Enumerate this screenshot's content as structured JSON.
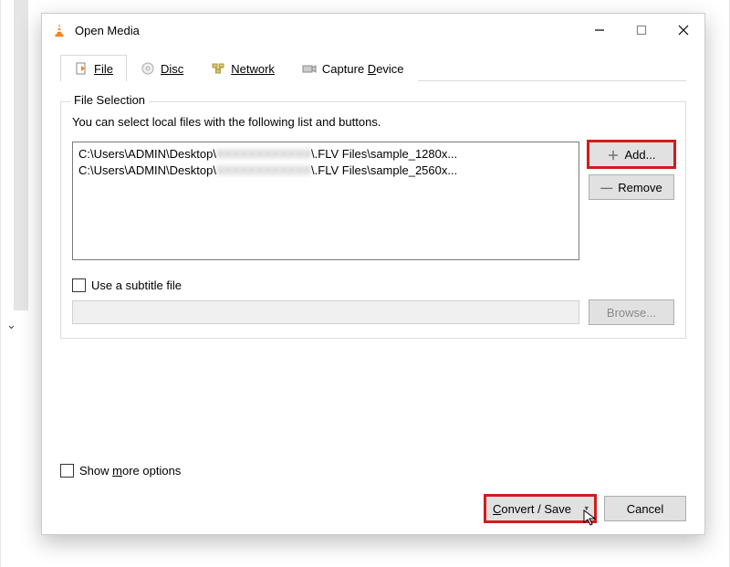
{
  "window": {
    "title": "Open Media"
  },
  "tabs": {
    "file": "File",
    "disc": "Disc",
    "network": "Network",
    "capture": "Capture Device"
  },
  "file_selection": {
    "legend": "File Selection",
    "hint": "You can select local files with the following list and buttons.",
    "items": [
      {
        "prefix": "C:\\Users\\ADMIN\\Desktop\\",
        "hidden": "XXXXXXXXXXXX",
        "suffix": "\\.FLV Files\\sample_1280x..."
      },
      {
        "prefix": "C:\\Users\\ADMIN\\Desktop\\",
        "hidden": "XXXXXXXXXXXX",
        "suffix": "\\.FLV Files\\sample_2560x..."
      }
    ],
    "add_label": "Add...",
    "remove_label": "Remove"
  },
  "subtitle": {
    "checkbox_label": "Use a subtitle file",
    "browse_label": "Browse..."
  },
  "more_options_label": "Show more options",
  "actions": {
    "convert_label": "Convert / Save",
    "cancel_label": "Cancel"
  }
}
